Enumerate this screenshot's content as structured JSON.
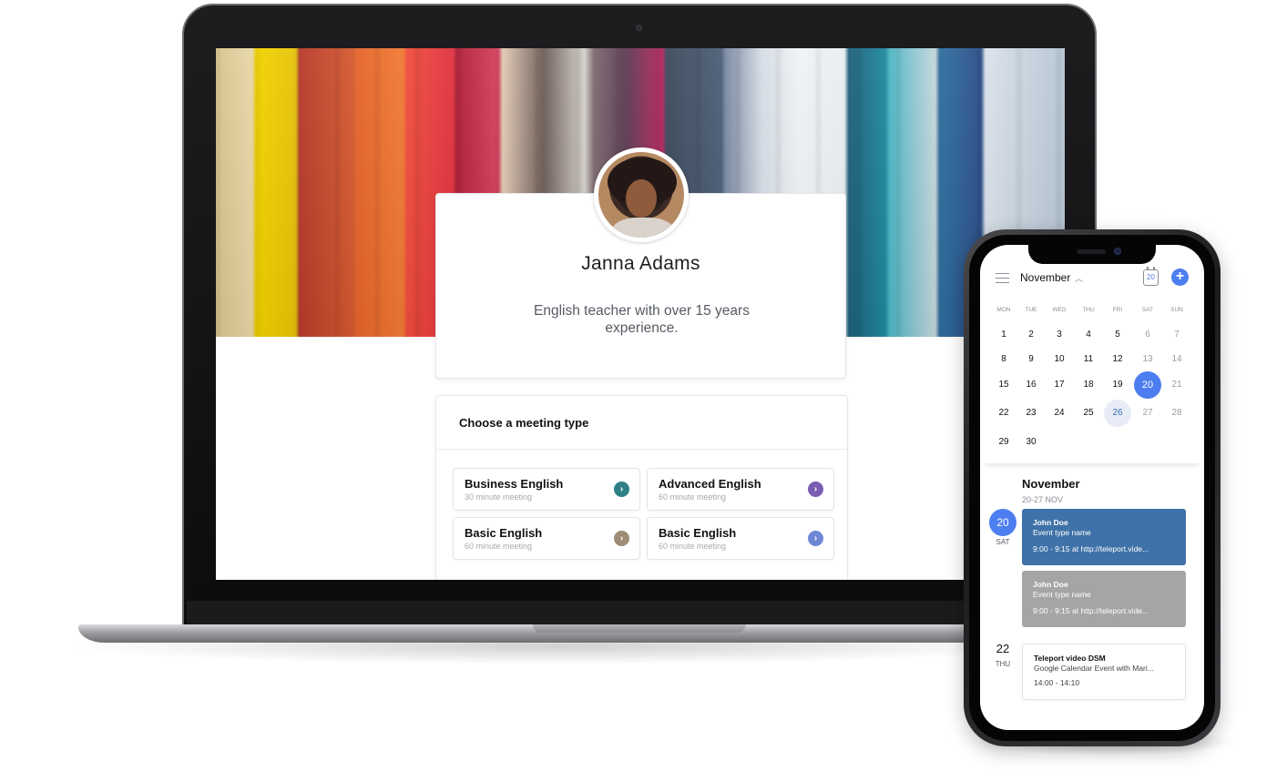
{
  "profile": {
    "name": "Janna Adams",
    "bio": "English teacher with over 15 years experience."
  },
  "meetings": {
    "title": "Choose a meeting type",
    "items": [
      {
        "name": "Business English",
        "duration": "30 minute meeting",
        "color": "#2f7f86"
      },
      {
        "name": "Advanced English",
        "duration": "60 minute meeting",
        "color": "#7a5cb0"
      },
      {
        "name": "Basic English",
        "duration": "60 minute meeting",
        "color": "#a08b75"
      },
      {
        "name": "Basic English",
        "duration": "60 minute meeting",
        "color": "#6f88d6"
      }
    ]
  },
  "phone": {
    "month": "November",
    "calendar_icon_day": "20",
    "weekdays": [
      "MON",
      "TUE",
      "WED",
      "THU",
      "FRI",
      "SAT",
      "SUN"
    ],
    "weeks": [
      [
        "1",
        "2",
        "3",
        "4",
        "5",
        "6",
        "7"
      ],
      [
        "8",
        "9",
        "10",
        "11",
        "12",
        "13",
        "14"
      ],
      [
        "15",
        "16",
        "17",
        "18",
        "19",
        "20",
        "21"
      ],
      [
        "22",
        "23",
        "24",
        "25",
        "26",
        "27",
        "28"
      ],
      [
        "29",
        "30",
        "",
        "",
        "",
        "",
        ""
      ]
    ],
    "selected_day": "20",
    "highlighted_day": "26",
    "agenda": {
      "month": "November",
      "range": "20-27 NOV",
      "day1": {
        "num": "20",
        "dow": "SAT"
      },
      "day2": {
        "num": "22",
        "dow": "THU"
      },
      "events": [
        {
          "title": "John Doe",
          "subtitle": "Event type name",
          "detail": "9:00 - 9:15 at http://teleport.vide..."
        },
        {
          "title": "John Doe",
          "subtitle": "Event type name",
          "detail": "9:00 - 9:15 at http://teleport.vide..."
        },
        {
          "title": "Teleport video DSM",
          "subtitle": "Google Calendar Event with Mari...",
          "detail": "14:00 - 14:10"
        }
      ]
    },
    "accent": "#4d7ef0"
  }
}
